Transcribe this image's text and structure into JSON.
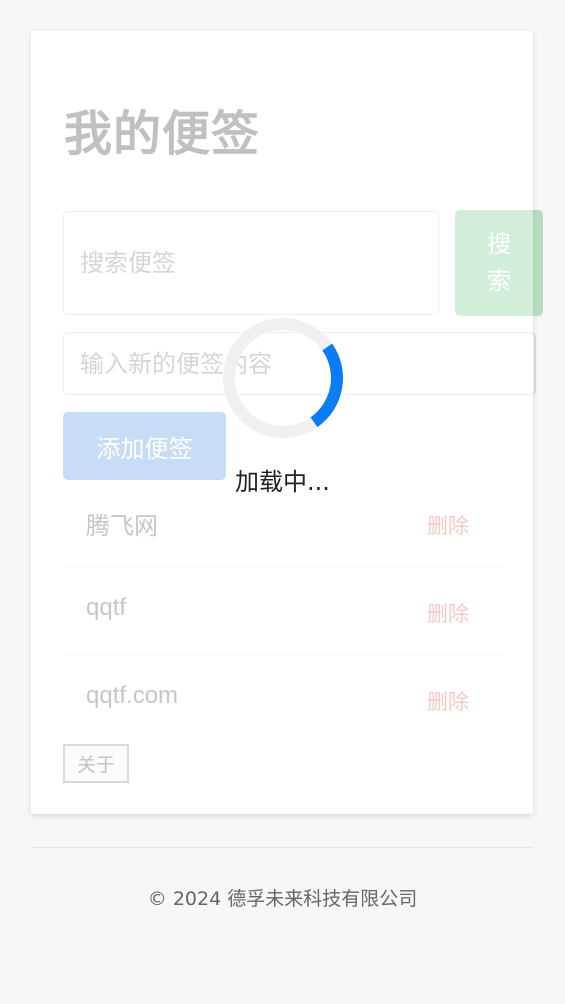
{
  "app": {
    "title": "我的便签"
  },
  "search": {
    "placeholder": "搜索便签",
    "value": "",
    "button_label": "搜索",
    "button_color": "#28a745"
  },
  "new_note": {
    "placeholder": "输入新的便签内容",
    "value": "",
    "add_button_label": "添加便签",
    "add_button_color": "#4a90e2"
  },
  "notes": [
    {
      "text": "腾飞网",
      "delete_label": "删除"
    },
    {
      "text": "qqtf",
      "delete_label": "删除"
    },
    {
      "text": "qqtf.com",
      "delete_label": "删除"
    }
  ],
  "about": {
    "label": "关于"
  },
  "loading": {
    "text": "加载中...",
    "spinner_color": "#0a7cf5"
  },
  "footer": {
    "text": "© 2024 德孚未来科技有限公司"
  },
  "colors": {
    "delete": "#e74c3c",
    "background": "#f7f7f7"
  }
}
